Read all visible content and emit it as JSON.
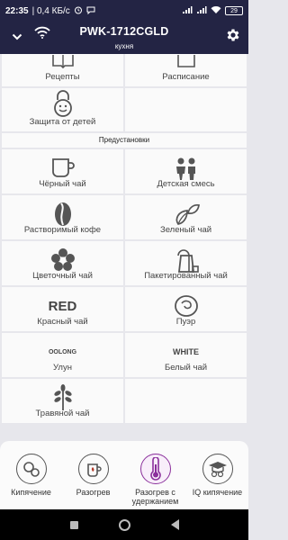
{
  "status_bar": {
    "time": "22:35",
    "network_speed": "| 0,4 КБ/с",
    "battery": "29"
  },
  "header": {
    "title": "PWK-1712CGLD",
    "subtitle": "кухня"
  },
  "functions": {
    "recipes": "Рецепты",
    "schedule": "Расписание",
    "child_lock": "Защита от детей"
  },
  "presets": {
    "section_title": "Предустановки",
    "items": [
      {
        "label": "Чёрный чай",
        "icon": "cup-icon"
      },
      {
        "label": "Детская смесь",
        "icon": "kids-icon"
      },
      {
        "label": "Растворимый кофе",
        "icon": "coffee-bean-icon"
      },
      {
        "label": "Зеленый чай",
        "icon": "green-tea-leaf-icon"
      },
      {
        "label": "Цветочный чай",
        "icon": "flower-icon"
      },
      {
        "label": "Пакетированный чай",
        "icon": "tea-bag-icon"
      },
      {
        "label": "Красный чай",
        "icon": "red-text-icon",
        "logo_text": "RED"
      },
      {
        "label": "Пуэр",
        "icon": "puer-icon"
      },
      {
        "label": "Улун",
        "icon": "oolong-text-icon",
        "logo_text": "OOLONG"
      },
      {
        "label": "Белый чай",
        "icon": "white-text-icon",
        "logo_text": "WHITE"
      },
      {
        "label": "Травяной чай",
        "icon": "herb-icon"
      }
    ]
  },
  "bottom_tabs": [
    {
      "label": "Кипячение",
      "icon": "boil-icon"
    },
    {
      "label": "Разогрев",
      "icon": "heat-icon"
    },
    {
      "label": "Разогрев с удержанием",
      "label_line1": "Разогрев с",
      "label_line2": "удержанием",
      "icon": "thermometer-icon",
      "active": true
    },
    {
      "label": "IQ кипячение",
      "icon": "iq-boil-icon"
    }
  ],
  "colors": {
    "header_bg": "#232444",
    "active_accent": "#8a2f9b",
    "page_bg": "#e7e7ec"
  }
}
